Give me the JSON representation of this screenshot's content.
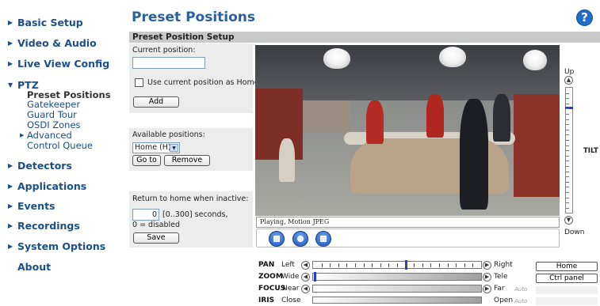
{
  "sidebar": {
    "items": [
      {
        "label": "Basic Setup"
      },
      {
        "label": "Video & Audio"
      },
      {
        "label": "Live View Config"
      },
      {
        "label": "PTZ"
      },
      {
        "label": "Detectors"
      },
      {
        "label": "Applications"
      },
      {
        "label": "Events"
      },
      {
        "label": "Recordings"
      },
      {
        "label": "System Options"
      },
      {
        "label": "About"
      }
    ],
    "ptz_sub": [
      {
        "label": "Preset Positions"
      },
      {
        "label": "Gatekeeper"
      },
      {
        "label": "Guard Tour"
      },
      {
        "label": "OSDI Zones"
      },
      {
        "label": "Advanced"
      },
      {
        "label": "Control Queue"
      }
    ]
  },
  "page": {
    "title": "Preset Positions",
    "section_title": "Preset Position Setup"
  },
  "preset_form": {
    "current_position_label": "Current position:",
    "current_position_value": "",
    "use_current_label": "Use current position as Home",
    "add_button": "Add",
    "available_label": "Available positions:",
    "available_selected": "Home (H)",
    "goto_button": "Go to",
    "remove_button": "Remove",
    "return_label": "Return to home when inactive:",
    "return_value": "0",
    "return_units": "[0..300] seconds,",
    "disabled_note": "0 = disabled",
    "save_button": "Save"
  },
  "video": {
    "status": "Playing, Motion JPEG"
  },
  "tilt": {
    "up_label": "Up",
    "down_label": "Down",
    "label": "TILT",
    "level": 0.15
  },
  "controls": {
    "pan": {
      "name": "PAN",
      "left": "Left",
      "right": "Right",
      "position": 0.55
    },
    "zoom": {
      "name": "ZOOM",
      "left": "Wide",
      "right": "Tele",
      "position": 0.0
    },
    "focus": {
      "name": "FOCUS",
      "left": "Near",
      "right": "Far",
      "auto": "Auto"
    },
    "iris": {
      "name": "IRIS",
      "left": "Close",
      "right": "Open",
      "auto": "Auto"
    }
  },
  "side_buttons": {
    "home": "Home",
    "ctrl_panel": "Ctrl panel"
  },
  "colors": {
    "nav_link": "#1a4f8a",
    "title": "#2a5f9e",
    "handle": "#1d3fcf",
    "section_bg": "#c9c9c9",
    "panel_bg": "#ececec"
  }
}
